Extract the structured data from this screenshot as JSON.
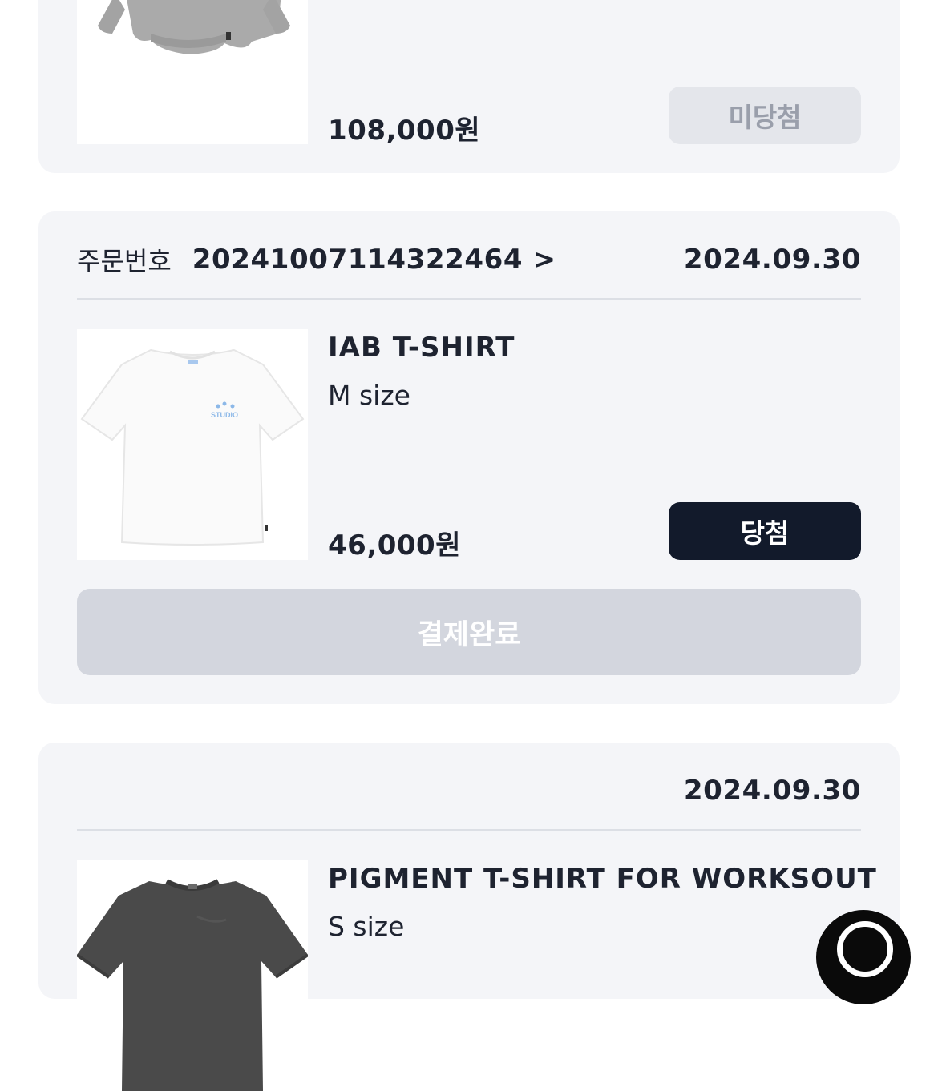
{
  "orders": [
    {
      "price": "108,000원",
      "result_label": "미당첨"
    },
    {
      "order_label": "주문번호",
      "order_number": "20241007114322464 >",
      "date": "2024.09.30",
      "product_name": "IAB T-SHIRT",
      "size": "M size",
      "price": "46,000원",
      "result_label": "당첨",
      "payment_status": "결제완료",
      "print_text": "STUDIO"
    },
    {
      "date": "2024.09.30",
      "product_name": "PIGMENT T-SHIRT FOR WORKSOUT",
      "size": "S size"
    }
  ],
  "colors": {
    "card_bg": "#f4f5f8",
    "win_badge": "#121a2b",
    "lose_badge": "#e4e6eb",
    "payment_done": "#d3d6de",
    "print_blue": "#8cb8e8"
  },
  "icons": {
    "floating_button": "chat-icon"
  }
}
